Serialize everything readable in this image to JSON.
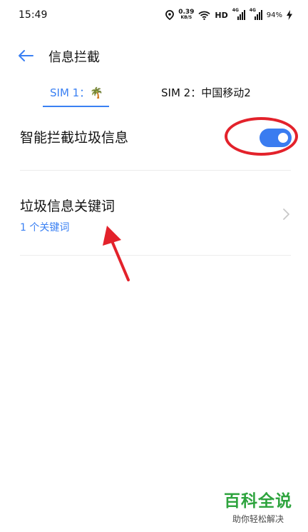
{
  "status_bar": {
    "time": "15:49",
    "speed_value": "0.39",
    "speed_unit": "KB/S",
    "hd": "HD",
    "sim1_network": "4G",
    "sim2_network": "4G",
    "battery": "94%"
  },
  "header": {
    "title": "信息拦截",
    "back_icon": "arrow-left-icon"
  },
  "tabs": [
    {
      "label": "SIM 1：🌴",
      "active": true
    },
    {
      "label": "SIM 2：中国移动2",
      "active": false
    }
  ],
  "settings": {
    "spam_block_label": "智能拦截垃圾信息",
    "spam_block_enabled": true,
    "keywords_label": "垃圾信息关键词",
    "keywords_count": "1 个关键词"
  },
  "watermark": {
    "title": "百科全说",
    "subtitle": "助你轻松解决"
  },
  "colors": {
    "accent": "#3a80f3",
    "annotation": "#e3222b",
    "watermark": "#2ea43e"
  }
}
